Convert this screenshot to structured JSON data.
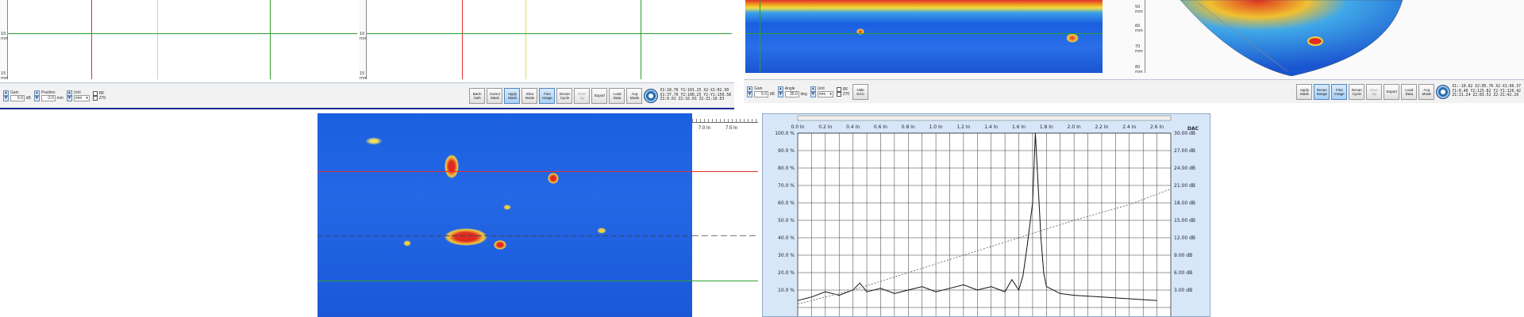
{
  "top_left": {
    "ruler_labels": [
      "10 mm",
      "15 mm"
    ],
    "ruler_labels_right": [
      "10 mm",
      "15 mm"
    ],
    "gain": {
      "label": "Gain",
      "value": "5.0",
      "unit": "dB"
    },
    "position": {
      "label": "Position",
      "value": "-2.0",
      "unit": "mm"
    },
    "unit": {
      "label": "Unit",
      "value": "mm"
    },
    "rf_label": "RF",
    "angle270_label": "270",
    "buttons": [
      "Back-\nlash",
      "Cursor\nMask",
      "Apply\nMask",
      "Slice\nMode",
      "Fine\nImage",
      "Decan\nCycle",
      "Over-\nlay",
      "Export",
      "Load\nData",
      "Acq\nMode"
    ],
    "readout": [
      "X1:18.76 Y1:101.25 X2-X1:02.50",
      "X1:37.76 Y2:100.25 Y2-Y1:150.58",
      "Z1:0.01 Z2:16.03 Z2-Z1:16.03"
    ]
  },
  "top_right": {
    "ruler_labels": [
      "50 mm",
      "60 mm",
      "70 mm",
      "80 mm"
    ],
    "gain": {
      "label": "Gain",
      "value": "5.0",
      "unit": "dB"
    },
    "angle": {
      "label": "Angle",
      "value": "35.0",
      "unit": "deg"
    },
    "unit": {
      "label": "Unit",
      "value": "mm"
    },
    "rf_label": "RF",
    "angle270_label": "270",
    "hide_dac_label": "Hide\nDAC",
    "buttons": [
      "Apply\nMask",
      "Decan\nRange",
      "Fine\nImage",
      "Decan\nCycle",
      "Over-\nlay",
      "Export",
      "Load\nData",
      "Acq\nMode"
    ],
    "readout": [
      "X1:-10.62 X2:85.76 X2-X1:96.37",
      "Y1:8.40 Y2:125.82 Y2-Y1:126.42",
      "Z1:21.24 Z2:83.52 Z2-Z1:42.29"
    ]
  },
  "bottom_left": {
    "ruler_labels": [
      "7.0 In",
      "7.5 In"
    ]
  },
  "ascan_chart": {
    "dac_label": "DAC",
    "x_ticks": [
      "0.0 In",
      "0.2 In",
      "0.4 In",
      "0.6 In",
      "0.8 In",
      "1.0 In",
      "1.2 In",
      "1.4 In",
      "1.6 In",
      "1.8 In",
      "2.0 In",
      "2.2 In",
      "2.4 In",
      "2.6 In"
    ],
    "y_left_ticks": [
      "100.0 %",
      "90.0 %",
      "80.0 %",
      "70.0 %",
      "60.0 %",
      "50.0 %",
      "40.0 %",
      "30.0 %",
      "20.0 %",
      "10.0 %"
    ],
    "y_right_ticks": [
      "30.00 dB",
      "27.00 dB",
      "24.00 dB",
      "21.00 dB",
      "18.00 dB",
      "15.00 dB",
      "12.00 dB",
      "9.00 dB",
      "6.00 dB",
      "3.00 dB"
    ]
  },
  "chart_data": {
    "type": "line",
    "xlabel": "",
    "ylabel": "",
    "xlim": [
      0.0,
      2.7
    ],
    "ylim": [
      0,
      100
    ],
    "grid": true,
    "series": [
      {
        "x": [
          0.0,
          0.1,
          0.2,
          0.3,
          0.4,
          0.45,
          0.5,
          0.6,
          0.7,
          0.8,
          0.9,
          1.0,
          1.1,
          1.2,
          1.3,
          1.4,
          1.5,
          1.55,
          1.6,
          1.63,
          1.66,
          1.7,
          1.72,
          1.74,
          1.76,
          1.78,
          1.8,
          1.9,
          2.0,
          2.2,
          2.4,
          2.6
        ],
        "values": [
          4,
          6,
          9,
          7,
          10,
          14,
          9,
          11,
          8,
          10,
          12,
          9,
          11,
          13,
          10,
          12,
          9,
          16,
          10,
          18,
          35,
          60,
          100,
          70,
          40,
          20,
          12,
          8,
          7,
          6,
          5,
          4
        ]
      },
      {
        "x": [
          0.0,
          0.4,
          0.8,
          1.2,
          1.6,
          2.0,
          2.4,
          2.7
        ],
        "values": [
          2,
          10,
          20,
          30,
          40,
          50,
          59,
          68
        ]
      }
    ]
  },
  "colors": {
    "accent": "#4d86c4",
    "heat_bg": "#1a5fe0",
    "cursor_red": "#e23030",
    "cursor_green": "#2ca02c",
    "cursor_yellow": "#e8d84a"
  }
}
